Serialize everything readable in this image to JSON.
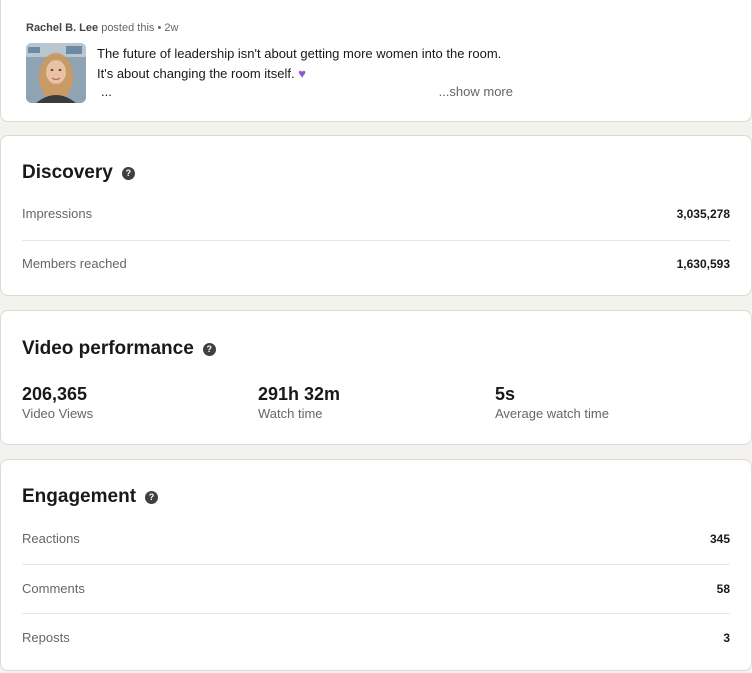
{
  "post": {
    "author": "Rachel B. Lee",
    "meta_suffix": " posted this • 2w",
    "line1": "The future of leadership isn't about getting more women into the room.",
    "line2": "It's about changing the room itself.",
    "ellipsis": "...",
    "show_more": "...show more"
  },
  "discovery": {
    "title": "Discovery",
    "rows": [
      {
        "label": "Impressions",
        "value": "3,035,278"
      },
      {
        "label": "Members reached",
        "value": "1,630,593"
      }
    ]
  },
  "video": {
    "title": "Video performance",
    "metrics": [
      {
        "value": "206,365",
        "label": "Video Views"
      },
      {
        "value": "291h 32m",
        "label": "Watch time"
      },
      {
        "value": "5s",
        "label": "Average watch time"
      }
    ]
  },
  "engagement": {
    "title": "Engagement",
    "rows": [
      {
        "label": "Reactions",
        "value": "345"
      },
      {
        "label": "Comments",
        "value": "58"
      },
      {
        "label": "Reposts",
        "value": "3"
      }
    ]
  },
  "icons": {
    "help": "question-circle-icon",
    "heart": "purple-heart-icon"
  },
  "colors": {
    "background": "#f4f2ee",
    "card": "#ffffff",
    "heart": "#8b5cc9"
  }
}
